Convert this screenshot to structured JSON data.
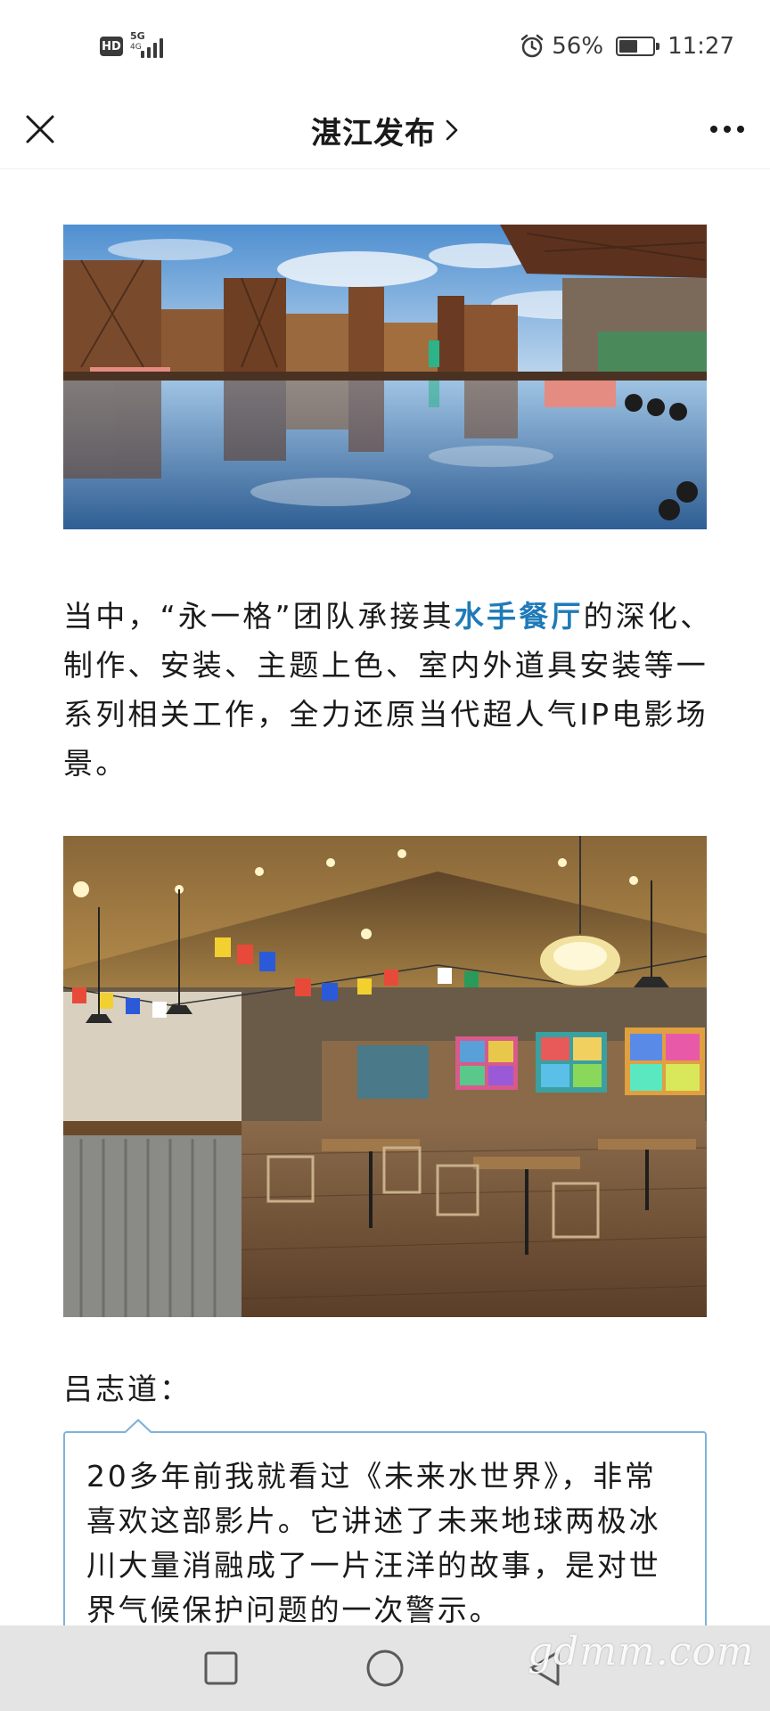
{
  "status_bar": {
    "hd": "HD",
    "network": "5G",
    "network_sub": "4G",
    "battery_percent": "56%",
    "battery_level": 0.56,
    "time": "11:27",
    "icons": [
      "signal-icon",
      "alarm-icon",
      "battery-icon"
    ]
  },
  "nav": {
    "title": "湛江发布",
    "icons": [
      "close-icon",
      "chevron-right-icon",
      "more-icon"
    ]
  },
  "article": {
    "paragraph": {
      "before": "当中，“永一格”团队承接其",
      "highlight": "水手餐厅",
      "after": "的深化、制作、安装、主题上色、室内外道具安装等一系列相关工作，全力还原当代超人气IP电影场景。"
    },
    "speaker": "吕志道：",
    "quote": "20多年前我就看过《未来水世界》，非常喜欢这部影片。它讲述了未来地球两极冰川大量消融成了一片汪洋的故事，是对世界气候保护问题的一次警示。"
  },
  "colors": {
    "highlight": "#1f7bb8",
    "quote_border": "#7fb3d8",
    "system_nav_bg": "#e4e4e4"
  },
  "system_nav": {
    "icons": [
      "recent-apps-icon",
      "home-icon",
      "back-icon"
    ]
  },
  "watermark": "gdmm.com"
}
